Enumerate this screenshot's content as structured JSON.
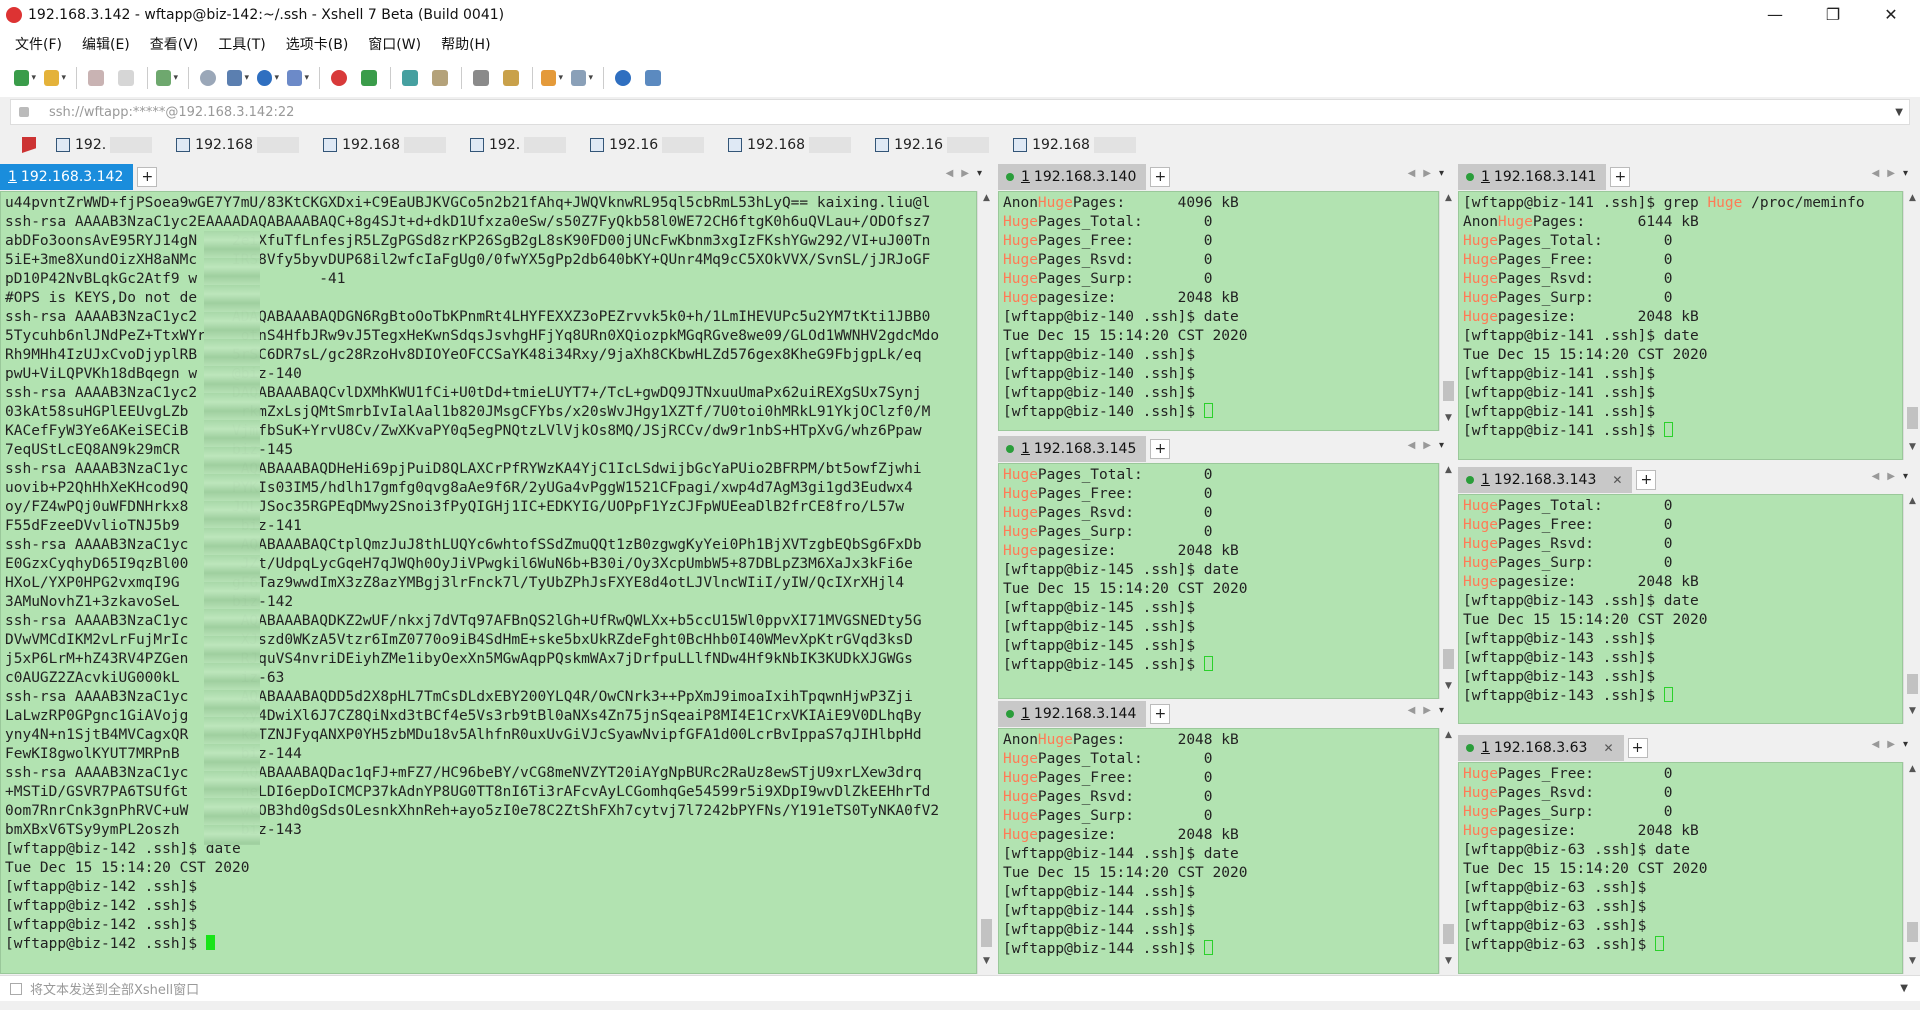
{
  "window": {
    "title": "192.168.3.142 - wftapp@biz-142:~/.ssh - Xshell 7 Beta (Build 0041)",
    "minimize": "—",
    "maximize": "❐",
    "close": "✕"
  },
  "menu": [
    "文件(F)",
    "编辑(E)",
    "查看(V)",
    "工具(T)",
    "选项卡(B)",
    "窗口(W)",
    "帮助(H)"
  ],
  "address": {
    "value": "ssh://wftapp:*****@192.168.3.142:22"
  },
  "quick_sessions": [
    "192.",
    "192.168",
    "192.168",
    "192.",
    "192.16",
    "192.168",
    "192.16",
    "192.168"
  ],
  "send_bar": {
    "placeholder": "将文本发送到全部Xshell窗口"
  },
  "colors": {
    "terminal_bg": "#b2e3b1",
    "highlight": "#ff7b56",
    "active_tab": "#1a8ddc",
    "cursor": "#18e418"
  },
  "panes": {
    "main": {
      "tab": {
        "num": "1",
        "label": "192.168.3.142"
      },
      "lines": [
        "u44pvntZrWWD+fjPSoea9wGE7Y7mU/83KtCKGXDxi+C9EaUBJKVGCo5n2b21fAhq+JWQVknwRL95ql5cbRmL53hLyQ== kaixing.liu@l",
        "ssh-rsa AAAAB3NzaC1yc2EAAAADAQABAAABAQC+8g4SJt+d+dkD1Ufxza0eSw/s50Z7FyQkb58l0WE72CH6ftgK0h6uQVLau+/ODOfsz7",
        "abDFo3oonsAvE95RYJ14gN    2eiXfuTfLnfesjR5LZgPGSd8zrKP26SgB2gL8sK90FD00jUNcFwKbnm3xgIzFKshYGw292/VI+uJ00Tn",
        "5iE+3me8XundOizXH8aNMc    IRS8Vfy5byvDUP68il2wfcIaFgUg0/0fwYX5gPp2db640bKY+QUnr4Mq9cC5XOkVVX/SvnSL/jJRJoGF",
        "pD10P42NvBLqkGc2Atf9 w              -41",
        "#OPS is KEYS,Do not de",
        "ssh-rsa AAAAB3NzaC1yc2    ADAQABAAABAQDGN6RgBtoOoTbKPnmRt4LHYFEXXZ3oPEZrvvk5k0+h/1LmIHEVUPc5u2YM7tKti1JBB0",
        "5Tycuhb6nlJNdPeZ+TtxWYr    otnS4HfbJRw9vJ5TegxHeKwnSdqsJsvhgHFjYq8URn0XQiozpkMGqRGve8we09/GLOd1WWNHV2gdcMdo",
        "Rh9MHh4IzUJxCvoDjyplRB    5rSC6DR7sL/gc28RzoHv8DIOYeOFCCSaYK48i34Rxy/9jaXh8CKbwHLZd576gex8KheG9FbjgpLk/eq",
        "pwU+ViLQPVKh18dBqegn w    @biz-140",
        "ssh-rsa AAAAB3NzaC1yc2    DAQABAAABAQCvlDXMhKWU1fCi+U0tDd+tmieLUYT7+/TcL+gwDQ9JTNxuuUmaPx62uiREXgSUx7Synj",
        "03kAt58suHGPlEEUvgLZb      rkmZxLsjQMtSmrbIvIalAal1b820JMsgCFYbs/x20sWvJHgy1XZTf/7U0toi0hMRkL91YkjOClzf0/M",
        "KACefFyW3Ye6AKeiSECiB     VjmfbSuK+YrvU8Cv/ZwXKvaPY0q5egPNQtzLVlVjkOs8MQ/JSjRCCv/dw9r1nbS+HTpXvG/whz6Ppaw",
        "7eqUStLcEQ8AN9k29mCR      biz-145",
        "ssh-rsa AAAAB3NzaC1yc      AQABAAABAQDHeHi69pjPuiD8QLAXCrPfRYWzKA4YjC1IcLSdwijbGcYaPUio2BFRPM/bt5owfZjwhi",
        "uovib+P2QhHhXeKHcod9Q     PYKIs03IM5/hdlh17gmfg0qvg8aAe9f6R/2yUGa4vPggW1521CFpagi/xwp4d7AgM3gi1gd3Eudwx4",
        "oy/FZ4wPQj0uWFDNHrkx8     JQLJSoc35RGPEqDMwy2Snoi3fPyQIGHj1IC+EDKYIG/UOPpF1YzCJFpWUEeaDlB2frCE8fro/L57w",
        "F55dFzeeDVvlioTNJ5b9       biz-141",
        "ssh-rsa AAAAB3NzaC1yc      AQABAAABAQCtplQmzJuJ8thLUQYc6whtofSSdZmuQQt1zB0zgwgKyYei0Ph1BjXVTzgbEQbSg6FxDb",
        "E0GzxCyqhyD65I9qzBl00      JZt/UdpqLycGqeH7qJWQh0OyJiVPwgkil6WuN6b+B30i/Oy3XcpUmbW5+87DBLpZ3M6XaJx3kFi6e",
        "HXoL/YXP0HPG2vxmqI9G      gF6Taz9wwdImX3zZ8azYMBgj3lrFnck7l/TyUbZPhJsFXYE8d4otLJVlncWIiI/yIW/QcIXrXHjl4",
        "3AMuNovhZ1+3zkavoSeL      biz-142",
        "ssh-rsa AAAAB3NzaC1yc      AQABAAABAQDKZ2wUF/nkxj7dVTq97AFBnQS2lGh+UfRwQWLXx+b5ccU15Wl0ppvXI71MVGSNEDty5G",
        "DVwVMCdIKM2vLrFujMrIc      XJszd0WKzA5Vtzr6ImZ0770o9iB4SdHmE+ske5bxUkRZdeFght0BcHhb0I40WMevXpKtrGVqd3ksD",
        "j5xP6LrM+hZ43RV4PZGen      RJquVS4nvriDEiyhZMe1ibyOexXn5MGwAqpPQskmWAx7jDrfpuLLlfNDw4Hf9kNbIK3KUDkXJGWGs",
        "c0AUGZ2ZAcvkiUG000kL       iz-63",
        "ssh-rsa AAAAB3NzaC1yc      AQABAAABAQDD5d2X8pHL7TmCsDLdxEBY200YLQ4R/OwCNrk3++PpXmJ9imoaIxihTpqwnHjwP3Zji",
        "LaLwzRP0GPgnc1GiAVojg      xy4DwiXl6J7CZ8QiNxd3tBCf4e5Vs3rb9tBl0aNXs4Zn75jnSqeaiP8MI4E1CrxVKIAiE9V0DLhqBy",
        "yny4N+n1SjtB4MVCagxQR      k5TZNJFyqANXP0YH5zbMDu18v5AlhfnR0uxUvGiVJcSyawNvipfGFA1d00LcrBvIppaS7qJIHlbpHd",
        "FewKI8gwolKYUT7MRPnB       biz-144",
        "ssh-rsa AAAAB3NzaC1yc      AQABAAABAQDac1qFJ+mFZ7/HC96beBY/vCG8meNVZYT20iAYgNpBURc2RaUz8ewSTjU9xrLXew3drq",
        "+MSTiD/GSVR7PA6TSUfGt      neLDI6epDoICMCP37kAdnYP8UG0TT8nI6Ti3rAFcvAyLCGomhqGe54599r5i9XDpI9wvDlZkEEHhrTd",
        "0om7RnrCnk3gnPhRVC+uW      wcOB3hd0gSdsOLesnkXhnReh+ayo5zI0e78C2ZtShFXh7cytvj7l7242bPYFNs/Y191eTS0TyNKA0fV2",
        "bmXBxV6TSy9ymPL2oszh       biz-143",
        "[wftapp@biz-142 .ssh]$ date",
        "Tue Dec 15 15:14:20 CST 2020",
        "[wftapp@biz-142 .ssh]$",
        "[wftapp@biz-142 .ssh]$",
        "[wftapp@biz-142 .ssh]$",
        "[wftapp@biz-142 .ssh]$ "
      ]
    },
    "p140": {
      "tab": {
        "num": "1",
        "label": "192.168.3.140"
      },
      "lines": [
        "AnonHugePages:      4096 kB",
        "HugePages_Total:       0",
        "HugePages_Free:        0",
        "HugePages_Rsvd:        0",
        "HugePages_Surp:        0",
        "Hugepagesize:       2048 kB",
        "[wftapp@biz-140 .ssh]$ date",
        "Tue Dec 15 15:14:20 CST 2020",
        "[wftapp@biz-140 .ssh]$",
        "[wftapp@biz-140 .ssh]$",
        "[wftapp@biz-140 .ssh]$",
        "[wftapp@biz-140 .ssh]$ "
      ]
    },
    "p145": {
      "tab": {
        "num": "1",
        "label": "192.168.3.145"
      },
      "lines": [
        "HugePages_Total:       0",
        "HugePages_Free:        0",
        "HugePages_Rsvd:        0",
        "HugePages_Surp:        0",
        "Hugepagesize:       2048 kB",
        "[wftapp@biz-145 .ssh]$ date",
        "Tue Dec 15 15:14:20 CST 2020",
        "[wftapp@biz-145 .ssh]$",
        "[wftapp@biz-145 .ssh]$",
        "[wftapp@biz-145 .ssh]$",
        "[wftapp@biz-145 .ssh]$ "
      ]
    },
    "p144": {
      "tab": {
        "num": "1",
        "label": "192.168.3.144"
      },
      "lines": [
        "AnonHugePages:      2048 kB",
        "HugePages_Total:       0",
        "HugePages_Free:        0",
        "HugePages_Rsvd:        0",
        "HugePages_Surp:        0",
        "Hugepagesize:       2048 kB",
        "[wftapp@biz-144 .ssh]$ date",
        "Tue Dec 15 15:14:20 CST 2020",
        "[wftapp@biz-144 .ssh]$",
        "[wftapp@biz-144 .ssh]$",
        "[wftapp@biz-144 .ssh]$",
        "[wftapp@biz-144 .ssh]$ "
      ]
    },
    "p141": {
      "tab": {
        "num": "1",
        "label": "192.168.3.141"
      },
      "lines": [
        "[wftapp@biz-141 .ssh]$ grep Huge /proc/meminfo",
        "AnonHugePages:      6144 kB",
        "HugePages_Total:       0",
        "HugePages_Free:        0",
        "HugePages_Rsvd:        0",
        "HugePages_Surp:        0",
        "Hugepagesize:       2048 kB",
        "[wftapp@biz-141 .ssh]$ date",
        "Tue Dec 15 15:14:20 CST 2020",
        "[wftapp@biz-141 .ssh]$",
        "[wftapp@biz-141 .ssh]$",
        "[wftapp@biz-141 .ssh]$",
        "[wftapp@biz-141 .ssh]$ "
      ]
    },
    "p143": {
      "tab": {
        "num": "1",
        "label": "192.168.3.143"
      },
      "lines": [
        "HugePages_Total:       0",
        "HugePages_Free:        0",
        "HugePages_Rsvd:        0",
        "HugePages_Surp:        0",
        "Hugepagesize:       2048 kB",
        "[wftapp@biz-143 .ssh]$ date",
        "Tue Dec 15 15:14:20 CST 2020",
        "[wftapp@biz-143 .ssh]$",
        "[wftapp@biz-143 .ssh]$",
        "[wftapp@biz-143 .ssh]$",
        "[wftapp@biz-143 .ssh]$ "
      ]
    },
    "p63": {
      "tab": {
        "num": "1",
        "label": "192.168.3.63"
      },
      "lines": [
        "HugePages_Free:        0",
        "HugePages_Rsvd:        0",
        "HugePages_Surp:        0",
        "Hugepagesize:       2048 kB",
        "[wftapp@biz-63 .ssh]$ date",
        "Tue Dec 15 15:14:20 CST 2020",
        "[wftapp@biz-63 .ssh]$",
        "[wftapp@biz-63 .ssh]$",
        "[wftapp@biz-63 .ssh]$",
        "[wftapp@biz-63 .ssh]$ "
      ]
    }
  }
}
